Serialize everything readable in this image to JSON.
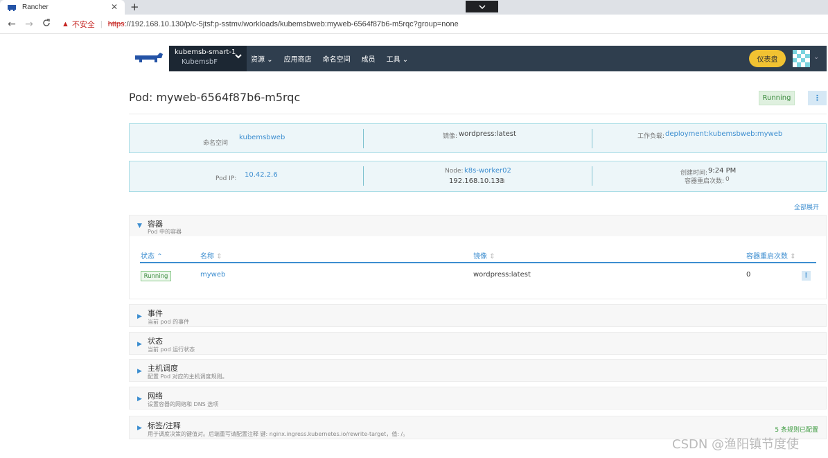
{
  "browser": {
    "tab_title": "Rancher",
    "tab_close": "✕",
    "new_tab": "+",
    "tabstrip_icon": "chevron-down",
    "nav": {
      "back": "←",
      "forward": "→",
      "reload": "C"
    },
    "insecure_label": "不安全",
    "url_scheme": "https",
    "url_rest": "://192.168.10.130/p/c-5jtsf:p-sstmv/workloads/kubemsbweb:myweb-6564f87b6-m5rqc?group=none"
  },
  "header": {
    "cluster_name": "kubemsb-smart-1",
    "project_name": "KubemsbF",
    "nav_items": [
      "资源",
      "应用商店",
      "命名空间",
      "成员",
      "工具"
    ],
    "nav_dropdown_flags": [
      true,
      false,
      false,
      false,
      true
    ],
    "dashboard_label": "仪表盘",
    "brand_color": "#2f3e4e"
  },
  "page": {
    "title": "Pod: myweb-6564f87b6-m5rqc",
    "status": "Running",
    "more_icon": "⋮"
  },
  "info": {
    "namespace_label": "命名空间",
    "namespace_value": "kubemsbweb",
    "image_label": "镜像:",
    "image_value": "wordpress:latest",
    "workload_label": "工作负载:",
    "workload_value": "deployment:kubemsbweb:myweb",
    "podip_label": "Pod IP:",
    "podip_value": "10.42.2.6",
    "node_label": "Node:",
    "node_value": "k8s-worker02",
    "node_ip": "192.168.10.133",
    "created_label": "创建时间:",
    "created_value": "9:24 PM",
    "restarts_label": "容器重启次数:",
    "restarts_value": "0"
  },
  "expand_all": "全部展开",
  "containers_section": {
    "title": "容器",
    "subtitle": "Pod 中的容器",
    "columns": [
      "状态",
      "名称",
      "镜像",
      "容器重启次数"
    ],
    "rows": [
      {
        "state": "Running",
        "name": "myweb",
        "image": "wordpress:latest",
        "restarts": "0"
      }
    ]
  },
  "sections": [
    {
      "title": "事件",
      "subtitle": "当前 pod 的事件"
    },
    {
      "title": "状态",
      "subtitle": "当前 pod 运行状态"
    },
    {
      "title": "主机调度",
      "subtitle": "配置 Pod 对应的主机调度规则。"
    },
    {
      "title": "网络",
      "subtitle": "设置容器的网络和 DNS 选项"
    },
    {
      "title": "标签/注释",
      "subtitle": "用于调度决策的键值对。后端重写请配置注释 键: nginx.ingress.kubernetes.io/rewrite-target，值: /。",
      "extra": "5 条规则已配置"
    }
  ],
  "watermark": "CSDN @渔阳镇节度使"
}
